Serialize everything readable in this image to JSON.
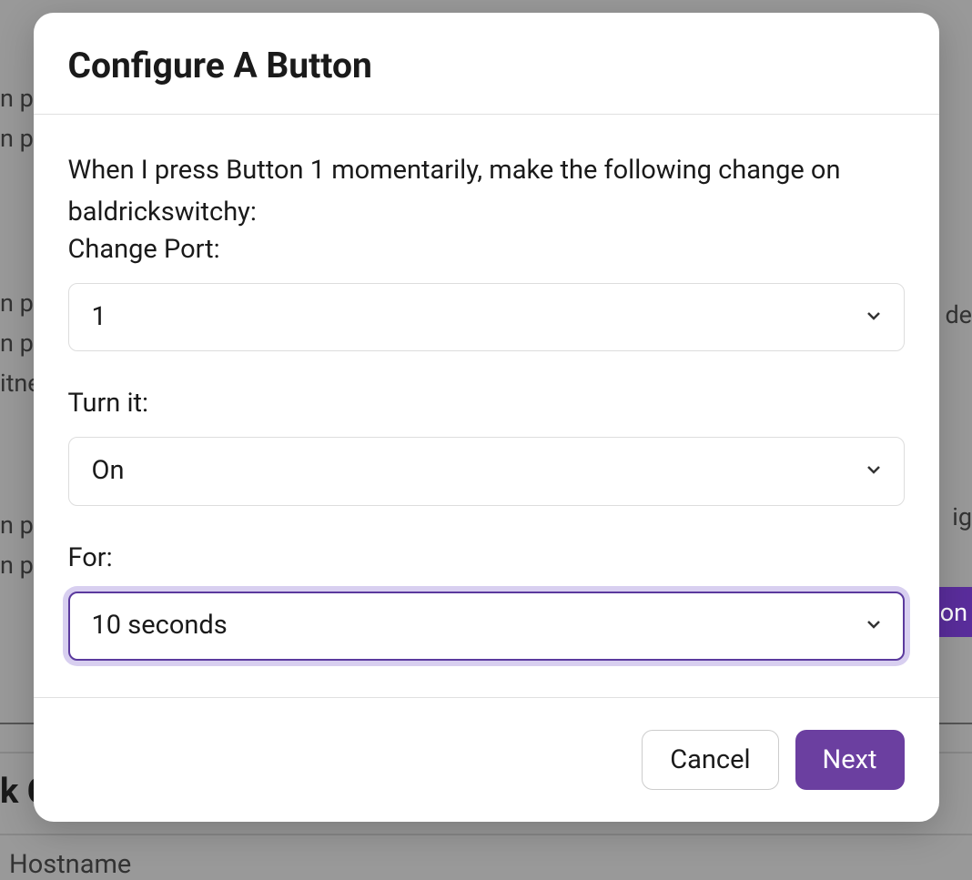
{
  "background": {
    "rows": [
      "n p",
      "n p",
      "n p",
      "n p",
      "itne",
      "n p",
      "n p"
    ],
    "right_text_1": "de",
    "right_text_2": "ig",
    "button_fragment": "on",
    "heading_fragment": "k C",
    "hostname_fragment": "Hostname"
  },
  "modal": {
    "title": "Configure A Button",
    "description": "When I press Button 1 momentarily, make the following change on baldrickswitchy:",
    "fields": {
      "port": {
        "label": "Change Port:",
        "value": "1"
      },
      "action": {
        "label": "Turn it:",
        "value": "On"
      },
      "duration": {
        "label": "For:",
        "value": "10 seconds"
      }
    },
    "buttons": {
      "cancel": "Cancel",
      "next": "Next"
    }
  }
}
